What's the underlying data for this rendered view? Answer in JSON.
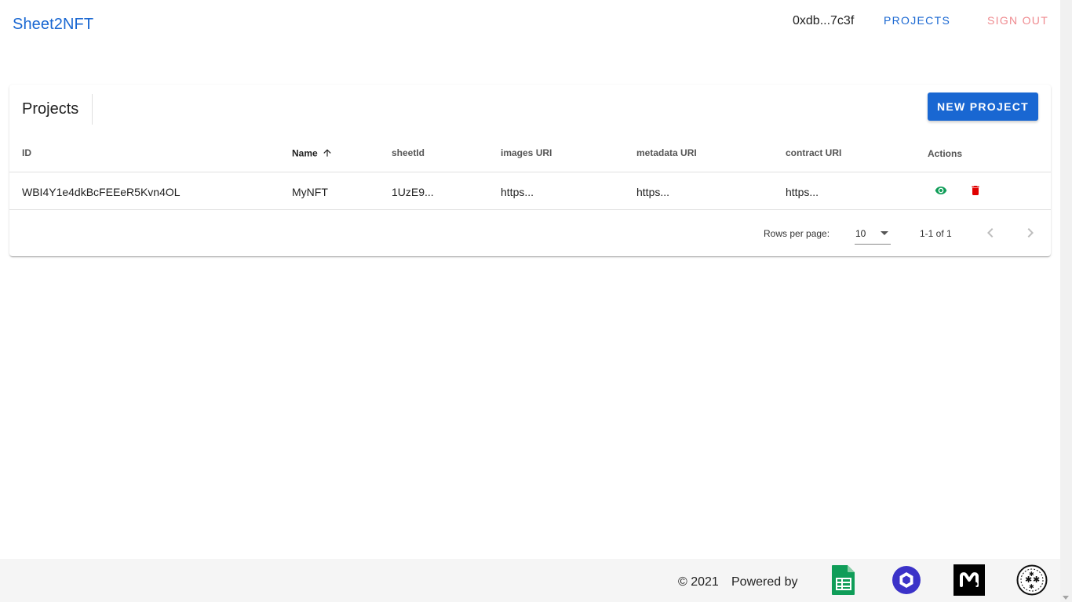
{
  "header": {
    "brand": "Sheet2NFT",
    "wallet": "0xdb...7c3f",
    "nav": {
      "projects": "PROJECTS",
      "sign_out": "SIGN OUT"
    }
  },
  "projects": {
    "title": "Projects",
    "new_button": "NEW PROJECT",
    "columns": [
      "ID",
      "Name",
      "sheetId",
      "images URI",
      "metadata URI",
      "contract URI",
      "Actions"
    ],
    "sorted_column": "Name",
    "rows": [
      {
        "id": "WBI4Y1e4dkBcFEEeR5Kvn4OL",
        "name": "MyNFT",
        "sheet_id": "1UzE9...",
        "images_uri": "https...",
        "metadata_uri": "https...",
        "contract_uri": "https..."
      }
    ],
    "pagination": {
      "rows_per_page_label": "Rows per page:",
      "rows_per_page": "10",
      "range": "1-1 of 1"
    }
  },
  "footer": {
    "copyright": "© 2021",
    "powered_by": "Powered by",
    "logos": [
      "google-sheets-logo",
      "chainlink-logo",
      "moralis-logo",
      "filecoin-nft-storage-logo"
    ]
  },
  "colors": {
    "primary": "#1967d2",
    "signout": "#ef8a8f",
    "view": "#0f9d58",
    "delete": "#e00000"
  }
}
